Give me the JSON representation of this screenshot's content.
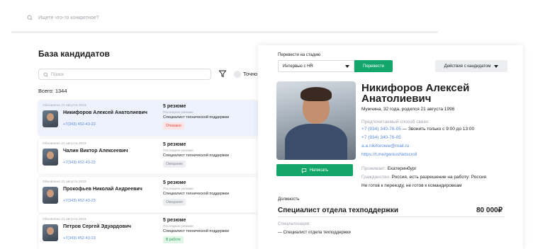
{
  "header": {
    "search_placeholder": "Ищете что-то конкретное?"
  },
  "left": {
    "title": "База кандидатов",
    "search_placeholder": "Поиск",
    "exact_label": "Точно",
    "total": "Всего: 1344",
    "cards": [
      {
        "updated": "Обновлено 21 августа 2023",
        "name": "Никифоров Алексей Анатолиевич",
        "phone": "+7(343) 452-43-23",
        "resumes": "5 резюме",
        "last_label": "Последнее резюме",
        "last_value": "Специалист технической поддержки",
        "status": "Отказано"
      },
      {
        "updated": "Обновлено 21 августа 2023",
        "name": "Чалин Виктор Алексеевич",
        "phone": "+7(343) 452-43-23",
        "resumes": "5 резюме",
        "last_label": "Последнее резюме",
        "last_value": "Специалист технической поддержки",
        "status": "Ожидание"
      },
      {
        "updated": "Обновлено 21 августа 2023",
        "name": "Прокофьев Николай Андреевич",
        "phone": "+7(343) 452-43-23",
        "resumes": "5 резюме",
        "last_label": "Последнее резюме",
        "last_value": "Специалист технической поддержки",
        "status": "Ожидание"
      },
      {
        "updated": "Обновлено 21 августа 2023",
        "name": "Петров Сергей Эдуардович",
        "phone": "+7(343) 452-43-23",
        "resumes": "5 резюме",
        "last_label": "Последнее резюме",
        "last_value": "Специалист технической поддержки",
        "status": "В работе"
      }
    ]
  },
  "panel": {
    "stage_label": "Перевести на стадию",
    "stage_value": "Интервью с HR",
    "move_button": "Перевести",
    "actions_button": "Действия с кандидатом",
    "write_button": "Написать",
    "name": "Никифоров Алексей Анатолиевич",
    "meta": "Мужчина, 32 года, родился 21 августа 1998",
    "contact_label": "Предпочитаемый способ связи:",
    "phone1": "+7 (934) 340-76-05",
    "phone1_note": " — Звонить только с 9:00 до 13:00",
    "phone2": "+7 (934) 340-76-05",
    "email": "a.a.nikiforoww@mail.ru",
    "telegram": "https://t.me/geniusNetscroll",
    "lives_label": "Проживает: ",
    "lives_value": "Екатеринбург",
    "citizenship_label": "Гражданство: ",
    "citizenship_value": "Россия, есть разрешение на работу: Россия",
    "relocation": "Не готов к переезду, не готов к командировкам",
    "position_label": "Должность",
    "position_title": "Специалист отдела техподдержки",
    "salary": "80 000₽",
    "spec_label": "Специализации:",
    "spec_value": "— Специалист отдела техподдержки"
  },
  "colors": {
    "accent": "#13a66b",
    "link": "#5a8ae0",
    "active_card": "#eef2fd"
  }
}
